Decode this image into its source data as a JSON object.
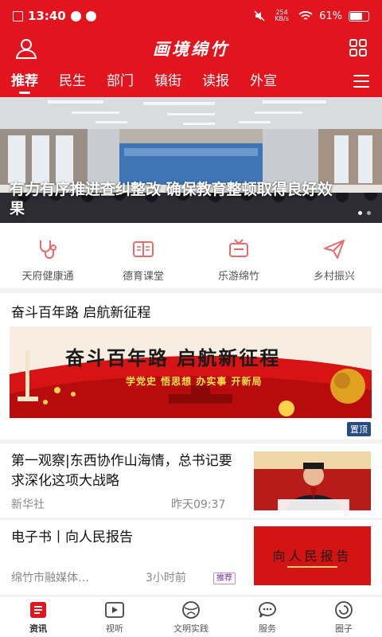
{
  "status": {
    "time": "13:40",
    "net_speed": "254 KB/s",
    "battery": "61%",
    "battery_level": 0.61
  },
  "header": {
    "logo": "画境绵竹"
  },
  "tabs": [
    {
      "label": "推荐",
      "active": true
    },
    {
      "label": "民生"
    },
    {
      "label": "部门"
    },
    {
      "label": "镇街"
    },
    {
      "label": "读报"
    },
    {
      "label": "外宣"
    }
  ],
  "banner": {
    "caption": "有力有序推进查纠整改 确保教育整顿取得良好效果"
  },
  "quick_links": [
    {
      "label": "天府健康通",
      "icon": "stethoscope-icon"
    },
    {
      "label": "德育课堂",
      "icon": "book-icon"
    },
    {
      "label": "乐游绵竹",
      "icon": "tv-icon"
    },
    {
      "label": "乡村振兴",
      "icon": "paper-plane-icon"
    }
  ],
  "section": {
    "title": "奋斗百年路  启航新征程",
    "poster_title": "奋斗百年路  启航新征程",
    "poster_sub": "学党史  悟思想  办实事  开新局",
    "pin_label": "置顶"
  },
  "news": [
    {
      "title": "第一观察|东西协作山海情，总书记要求深化这项大战略",
      "source": "新华社",
      "time": "昨天09:37"
    },
    {
      "title": "电子书丨向人民报告",
      "source": "绵竹市融媒体…",
      "time": "3小时前",
      "tag": "推荐",
      "thumb_text": "向人民报告"
    }
  ],
  "bottom_nav": [
    {
      "label": "资讯",
      "icon": "news-icon",
      "active": true
    },
    {
      "label": "视听",
      "icon": "play-icon"
    },
    {
      "label": "文明实践",
      "icon": "globe-icon"
    },
    {
      "label": "服务",
      "icon": "chat-icon"
    },
    {
      "label": "圈子",
      "icon": "circle-icon"
    }
  ],
  "colors": {
    "brand_red": "#e2141d",
    "tag_purple": "#7a2ca8",
    "pin_blue": "#294b83"
  }
}
